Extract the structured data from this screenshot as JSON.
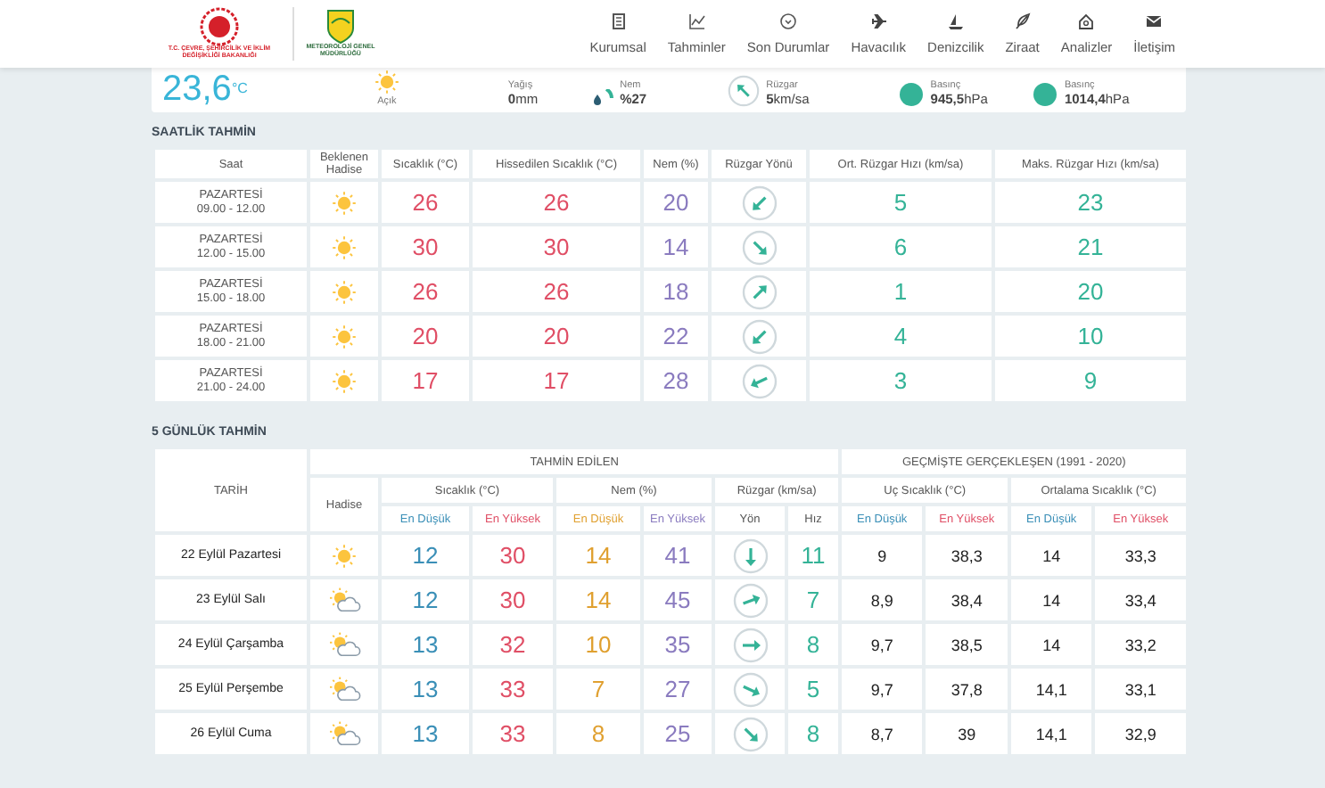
{
  "header": {
    "ministry_logo_text": "T.C. ÇEVRE, ŞEHİRCİLİK VE İKLİM DEĞİŞİKLİĞİ BAKANLIĞI",
    "mgm_logo_text": "METEOROLOJİ GENEL MÜDÜRLÜĞÜ",
    "nav": [
      {
        "label": "Kurumsal",
        "kind": "document"
      },
      {
        "label": "Tahminler",
        "kind": "chart"
      },
      {
        "label": "Son Durumlar",
        "kind": "clock"
      },
      {
        "label": "Havacılık",
        "kind": "plane"
      },
      {
        "label": "Denizcilik",
        "kind": "boat"
      },
      {
        "label": "Ziraat",
        "kind": "leaf"
      },
      {
        "label": "Analizler",
        "kind": "analysis"
      },
      {
        "label": "İletişim",
        "kind": "mail"
      }
    ]
  },
  "current": {
    "temperature": "23,6",
    "unit": "°C",
    "condition": "Açık",
    "weather": {
      "kind": "sunny"
    },
    "items": [
      {
        "kind": "rain",
        "label": "Yağış",
        "value": "0",
        "unit": "mm"
      },
      {
        "kind": "humidity",
        "label": "Nem",
        "value": "%27"
      },
      {
        "kind": "wind",
        "label": "Rüzgar",
        "value": "5",
        "unit": "km/sa",
        "arrow": {
          "kind": "nw"
        }
      },
      {
        "kind": "pressure",
        "label": "Basınç",
        "value": "945,5",
        "unit": "hPa"
      },
      {
        "kind": "pressure",
        "label": "Basınç",
        "value": "1014,4",
        "unit": "hPa"
      }
    ]
  },
  "hourly": {
    "title": "SAATLİK TAHMİN",
    "columns": [
      "Saat",
      "Beklenen Hadise",
      "Sıcaklık (°C)",
      "Hissedilen Sıcaklık (°C)",
      "Nem (%)",
      "Rüzgar Yönü",
      "Ort. Rüzgar Hızı (km/sa)",
      "Maks. Rüzgar Hızı (km/sa)"
    ],
    "rows": [
      {
        "day": "PAZARTESİ",
        "time": "09.00 - 12.00",
        "weather": {
          "kind": "sunny"
        },
        "temp": "26",
        "feels": "26",
        "humidity": "20",
        "arrow": {
          "kind": "sw"
        },
        "wind_avg": "5",
        "wind_max": "23"
      },
      {
        "day": "PAZARTESİ",
        "time": "12.00 - 15.00",
        "weather": {
          "kind": "sunny"
        },
        "temp": "30",
        "feels": "30",
        "humidity": "14",
        "arrow": {
          "kind": "se"
        },
        "wind_avg": "6",
        "wind_max": "21"
      },
      {
        "day": "PAZARTESİ",
        "time": "15.00 - 18.00",
        "weather": {
          "kind": "sunny"
        },
        "temp": "26",
        "feels": "26",
        "humidity": "18",
        "arrow": {
          "kind": "ne"
        },
        "wind_avg": "1",
        "wind_max": "20"
      },
      {
        "day": "PAZARTESİ",
        "time": "18.00 - 21.00",
        "weather": {
          "kind": "sunny"
        },
        "temp": "20",
        "feels": "20",
        "humidity": "22",
        "arrow": {
          "kind": "sw"
        },
        "wind_avg": "4",
        "wind_max": "10"
      },
      {
        "day": "PAZARTESİ",
        "time": "21.00 - 24.00",
        "weather": {
          "kind": "sunny"
        },
        "temp": "17",
        "feels": "17",
        "humidity": "28",
        "arrow": {
          "kind": "wsw"
        },
        "wind_avg": "3",
        "wind_max": "9"
      }
    ]
  },
  "daily": {
    "title": "5 GÜNLÜK TAHMİN",
    "date_header": "TARİH",
    "weather_header": "Hadise",
    "groups": [
      "TAHMİN EDİLEN",
      "GEÇMİŞTE GERÇEKLEŞEN (1991 - 2020)"
    ],
    "subgroups": [
      "Sıcaklık (°C)",
      "Nem (%)",
      "Rüzgar (km/sa)",
      "Uç Sıcaklık (°C)",
      "Ortalama Sıcaklık (°C)"
    ],
    "subheaders": [
      {
        "label": "En Düşük",
        "color": "#3a8fb7"
      },
      {
        "label": "En Yüksek",
        "color": "#e04f66"
      },
      {
        "label": "En Düşük",
        "color": "#e0a030"
      },
      {
        "label": "En Yüksek",
        "color": "#8a7bbf"
      },
      {
        "label": "Yön",
        "color": "#555555"
      },
      {
        "label": "Hız",
        "color": "#555555"
      },
      {
        "label": "En Düşük",
        "color": "#3a8fb7"
      },
      {
        "label": "En Yüksek",
        "color": "#e04f66"
      },
      {
        "label": "En Düşük",
        "color": "#3a8fb7"
      },
      {
        "label": "En Yüksek",
        "color": "#e04f66"
      }
    ],
    "rows": [
      {
        "date": "22 Eylül Pazartesi",
        "weather": {
          "kind": "sunny"
        },
        "temp_min": "12",
        "temp_max": "30",
        "hum_min": "14",
        "hum_max": "41",
        "arrow": {
          "kind": "s"
        },
        "wind_speed": "11",
        "ext_min": "9",
        "ext_max": "38,3",
        "avg_min": "14",
        "avg_max": "33,3"
      },
      {
        "date": "23 Eylül Salı",
        "weather": {
          "kind": "partly_cloudy"
        },
        "temp_min": "12",
        "temp_max": "30",
        "hum_min": "14",
        "hum_max": "45",
        "arrow": {
          "kind": "ene"
        },
        "wind_speed": "7",
        "ext_min": "8,9",
        "ext_max": "38,4",
        "avg_min": "14",
        "avg_max": "33,4"
      },
      {
        "date": "24 Eylül Çarşamba",
        "weather": {
          "kind": "partly_cloudy"
        },
        "temp_min": "13",
        "temp_max": "32",
        "hum_min": "10",
        "hum_max": "35",
        "arrow": {
          "kind": "e"
        },
        "wind_speed": "8",
        "ext_min": "9,7",
        "ext_max": "38,5",
        "avg_min": "14",
        "avg_max": "33,2"
      },
      {
        "date": "25 Eylül Perşembe",
        "weather": {
          "kind": "partly_cloudy"
        },
        "temp_min": "13",
        "temp_max": "33",
        "hum_min": "7",
        "hum_max": "27",
        "arrow": {
          "kind": "ese"
        },
        "wind_speed": "5",
        "ext_min": "9,7",
        "ext_max": "37,8",
        "avg_min": "14,1",
        "avg_max": "33,1"
      },
      {
        "date": "26 Eylül Cuma",
        "weather": {
          "kind": "partly_cloudy"
        },
        "temp_min": "13",
        "temp_max": "33",
        "hum_min": "8",
        "hum_max": "25",
        "arrow": {
          "kind": "se"
        },
        "wind_speed": "8",
        "ext_min": "8,7",
        "ext_max": "39",
        "avg_min": "14,1",
        "avg_max": "32,9"
      }
    ]
  }
}
